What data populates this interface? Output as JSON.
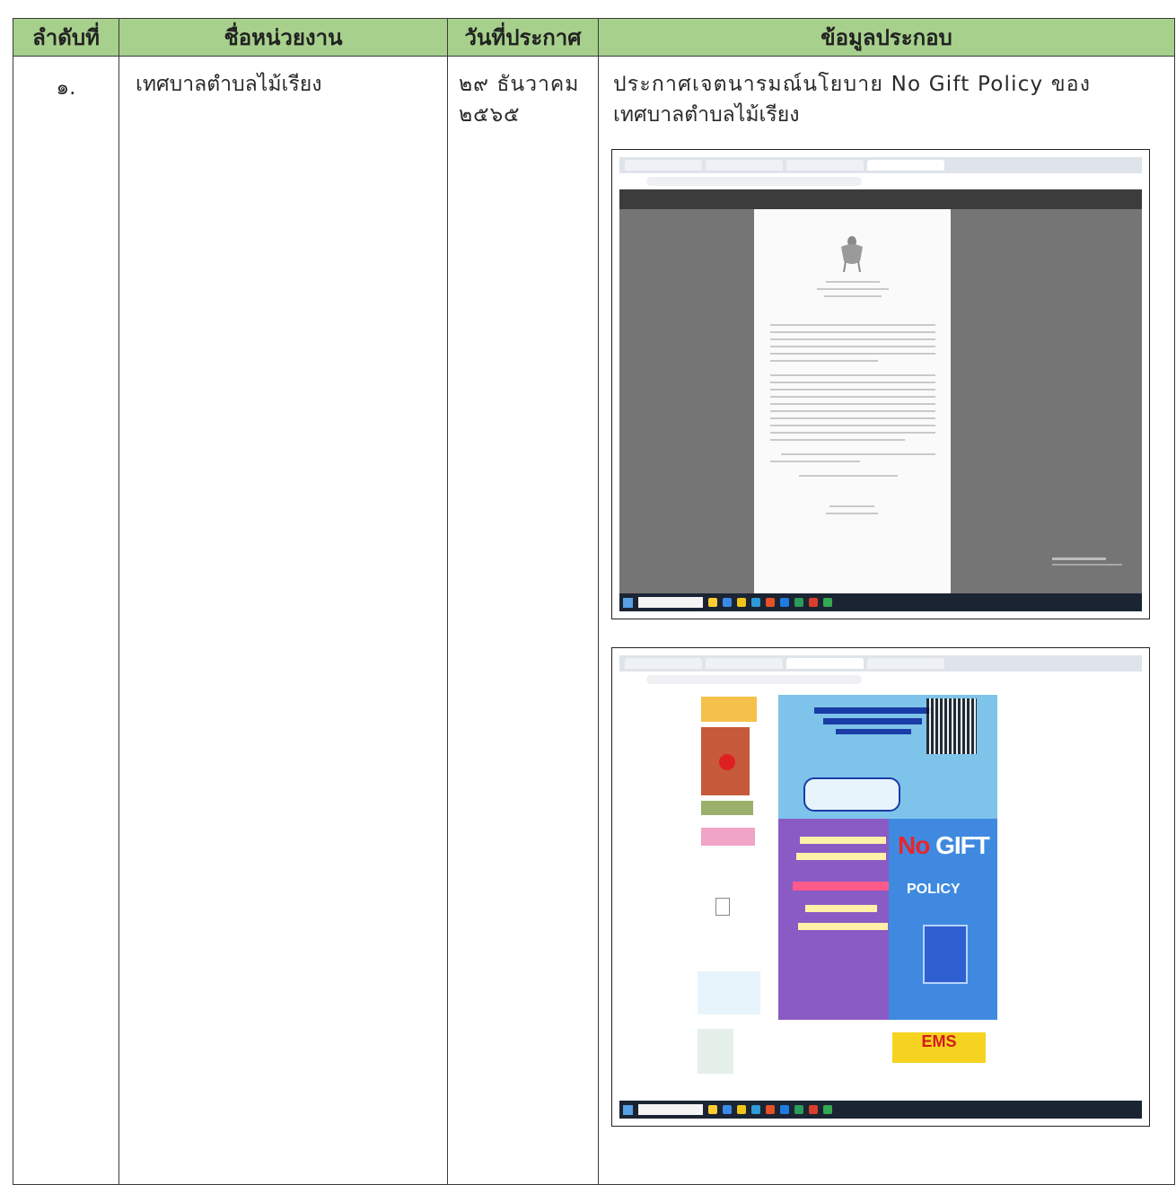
{
  "table": {
    "headers": [
      "ลำดับที่",
      "ชื่อหน่วยงาน",
      "วันที่ประกาศ",
      "ข้อมูลประกอบ"
    ],
    "rows": [
      {
        "no": "๑.",
        "agency": "เทศบาลตำบลไม้เรียง",
        "date_line1": "๒๙ ธันวาคม",
        "date_line2": "๒๕๖๕",
        "info_line1": "ประกาศเจตนารมณ์นโยบาย No Gift Policy ของ",
        "info_line2": "เทศบาลตำบลไม้เรียง"
      }
    ]
  },
  "screenshot_web": {
    "no_label": "No",
    "gift_label": "GIFT",
    "policy_label": "POLICY",
    "ems_label": "EMS"
  },
  "colors": {
    "header_bg": "#a6d08c",
    "border": "#3a3a3a"
  }
}
